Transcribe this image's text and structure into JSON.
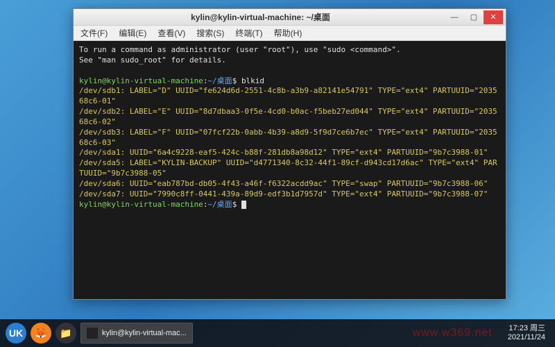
{
  "window": {
    "title": "kylin@kylin-virtual-machine: ~/桌面",
    "controls": {
      "min": "—",
      "max": "▢",
      "close": "✕"
    }
  },
  "menu": {
    "file": "文件(F)",
    "edit": "编辑(E)",
    "view": "查看(V)",
    "search": "搜索(S)",
    "terminal": "终端(T)",
    "help": "帮助(H)"
  },
  "term": {
    "banner": "To run a command as administrator (user \"root\"), use \"sudo <command>\".\nSee \"man sudo_root\" for details.\n",
    "prompt_user": "kylin@kylin-virtual-machine",
    "prompt_path": "~/桌面",
    "prompt_sym": "$",
    "cmd1": "blkid",
    "lines": {
      "l1": "/dev/sdb1: LABEL=\"D\" UUID=\"fe624d6d-2551-4c8b-a3b9-a82141e54791\" TYPE=\"ext4\" PARTUUID=\"203568c6-01\"",
      "l2": "/dev/sdb2: LABEL=\"E\" UUID=\"8d7dbaa3-0f5e-4cd0-b0ac-f5beb27ed044\" TYPE=\"ext4\" PARTUUID=\"203568c6-02\"",
      "l3": "/dev/sdb3: LABEL=\"F\" UUID=\"07fcf22b-0abb-4b39-a8d9-5f9d7ce6b7ec\" TYPE=\"ext4\" PARTUUID=\"203568c6-03\"",
      "l4": "/dev/sda1: UUID=\"6a4c9228-eaf5-424c-b88f-281db8a98d12\" TYPE=\"ext4\" PARTUUID=\"9b7c3988-01\"",
      "l5": "/dev/sda5: LABEL=\"KYLIN-BACKUP\" UUID=\"d4771340-8c32-44f1-89cf-d943cd17d6ac\" TYPE=\"ext4\" PARTUUID=\"9b7c3988-05\"",
      "l6": "/dev/sda6: UUID=\"eab787bd-db05-4f43-a46f-f6322acdd9ac\" TYPE=\"swap\" PARTUUID=\"9b7c3988-06\"",
      "l7": "/dev/sda7: UUID=\"7990c8ff-0441-439a-89d9-edf3b1d7957d\" TYPE=\"ext4\" PARTUUID=\"9b7c3988-07\""
    }
  },
  "taskbar": {
    "launcher_glyph": "UK",
    "firefox_glyph": "🦊",
    "files_glyph": "📁",
    "task_label": "kylin@kylin-virtual-mac...",
    "watermark": "www.w369.net",
    "time": "17:23 周三",
    "date": "2021/11/24"
  }
}
